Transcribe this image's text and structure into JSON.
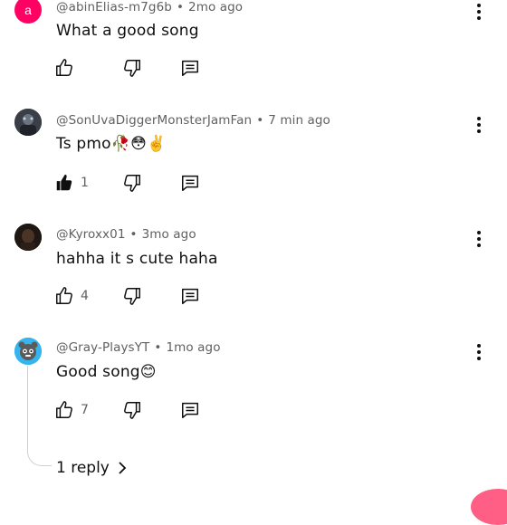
{
  "colors": {
    "avatar_a_bg": "#ff0063",
    "secondary_text": "#606060",
    "primary_text": "#0f0f0f",
    "accent_pink": "#ff4e77"
  },
  "comments": [
    {
      "avatar_letter": "a",
      "author": "@abinElias-m7g6b",
      "time": "2mo ago",
      "text": "What a good song",
      "likes": "",
      "liked": false
    },
    {
      "author": "@SonUvaDiggerMonsterJamFan",
      "time": "7 min ago",
      "text": "Ts pmo🥀😳✌️",
      "likes": "1",
      "liked": true
    },
    {
      "author": "@Kyroxx01",
      "time": "3mo ago",
      "text": "hahha it s cute haha",
      "likes": "4",
      "liked": false
    },
    {
      "author": "@Gray-PlaysYT",
      "time": "1mo ago",
      "text": "Good song😊",
      "likes": "7",
      "liked": false,
      "replies_label": "1 reply"
    }
  ],
  "separator": "•",
  "icons": [
    "like-icon",
    "dislike-icon",
    "reply-icon",
    "more-vert-icon",
    "chevron-right-icon"
  ]
}
